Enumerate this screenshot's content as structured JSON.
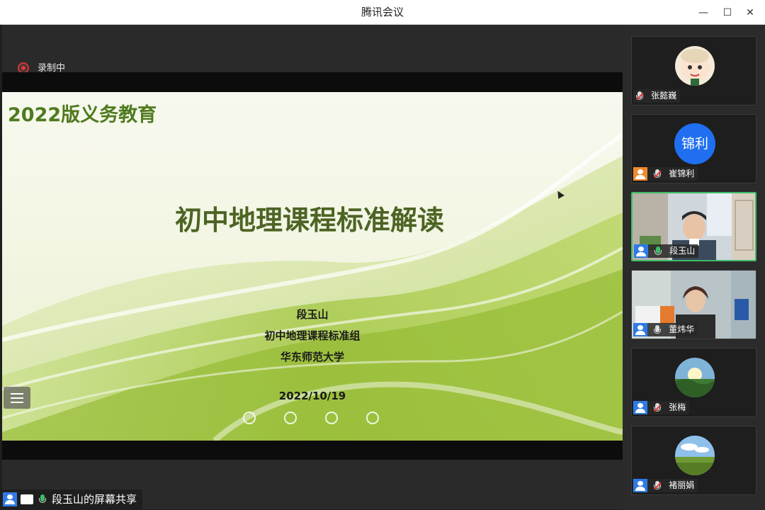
{
  "window": {
    "title": "腾讯会议",
    "minimize_glyph": "—",
    "maximize_glyph": "☐",
    "close_glyph": "✕"
  },
  "recording": {
    "label": "录制中",
    "indicator_color": "#dd3333"
  },
  "slide": {
    "header": "2022版义务教育",
    "title": "初中地理课程标准解读",
    "presenter": "段玉山",
    "group": "初中地理课程标准组",
    "university": "华东师范大学",
    "date": "2022/10/19",
    "accent_color": "#4f7a1e"
  },
  "share_status": {
    "label": "段玉山的屏幕共享"
  },
  "participants": [
    {
      "name": "张懿巍",
      "avatar": "cartoon-avatar",
      "mic": "muted",
      "role_badge": false,
      "active": false
    },
    {
      "name": "崔锦利",
      "avatar_text": "锦利",
      "mic": "muted",
      "role_badge": true,
      "active": false
    },
    {
      "name": "段玉山",
      "avatar": "video-feed",
      "mic": "live",
      "role_badge": false,
      "active": true
    },
    {
      "name": "董炜华",
      "avatar": "video-feed",
      "mic": "on",
      "role_badge": false,
      "active": false
    },
    {
      "name": "张梅",
      "avatar": "landscape-sunrise",
      "mic": "muted",
      "role_badge": false,
      "active": false
    },
    {
      "name": "褚丽娟",
      "avatar": "landscape-field",
      "mic": "muted",
      "role_badge": false,
      "active": false
    }
  ],
  "colors": {
    "speaking_border": "#3ebd68",
    "user_icon": "#2f7ae5",
    "host_icon": "#f08a2c"
  }
}
